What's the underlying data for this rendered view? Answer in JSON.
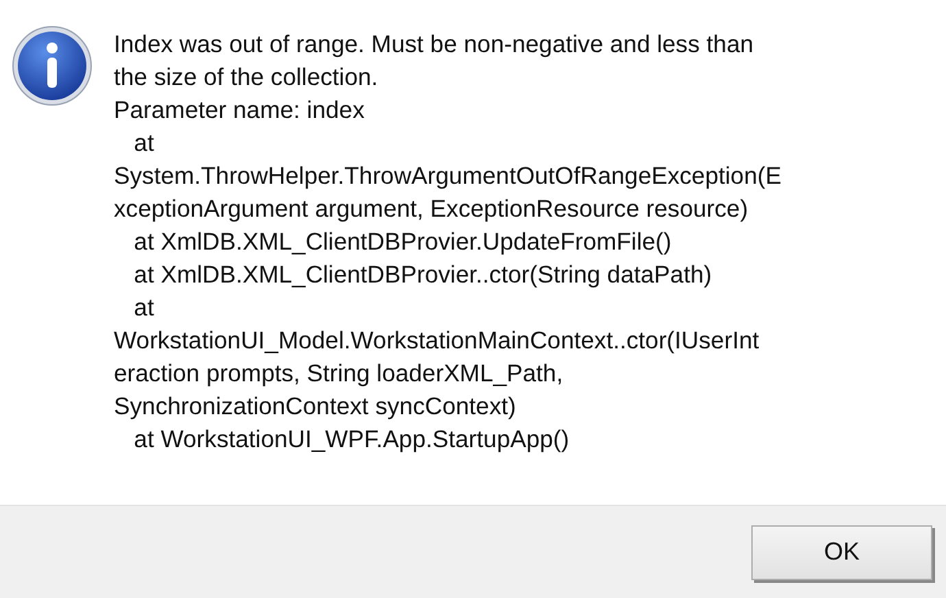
{
  "message_lines": [
    "Index was out of range. Must be non-negative and less than",
    "the size of the collection.",
    "Parameter name: index",
    "   at",
    "System.ThrowHelper.ThrowArgumentOutOfRangeException(E",
    "xceptionArgument argument, ExceptionResource resource)",
    "   at XmlDB.XML_ClientDBProvier.UpdateFromFile()",
    "   at XmlDB.XML_ClientDBProvier..ctor(String dataPath)",
    "   at",
    "WorkstationUI_Model.WorkstationMainContext..ctor(IUserInt",
    "eraction prompts, String loaderXML_Path,",
    "SynchronizationContext syncContext)",
    "   at WorkstationUI_WPF.App.StartupApp()"
  ],
  "buttons": [
    "OK"
  ]
}
